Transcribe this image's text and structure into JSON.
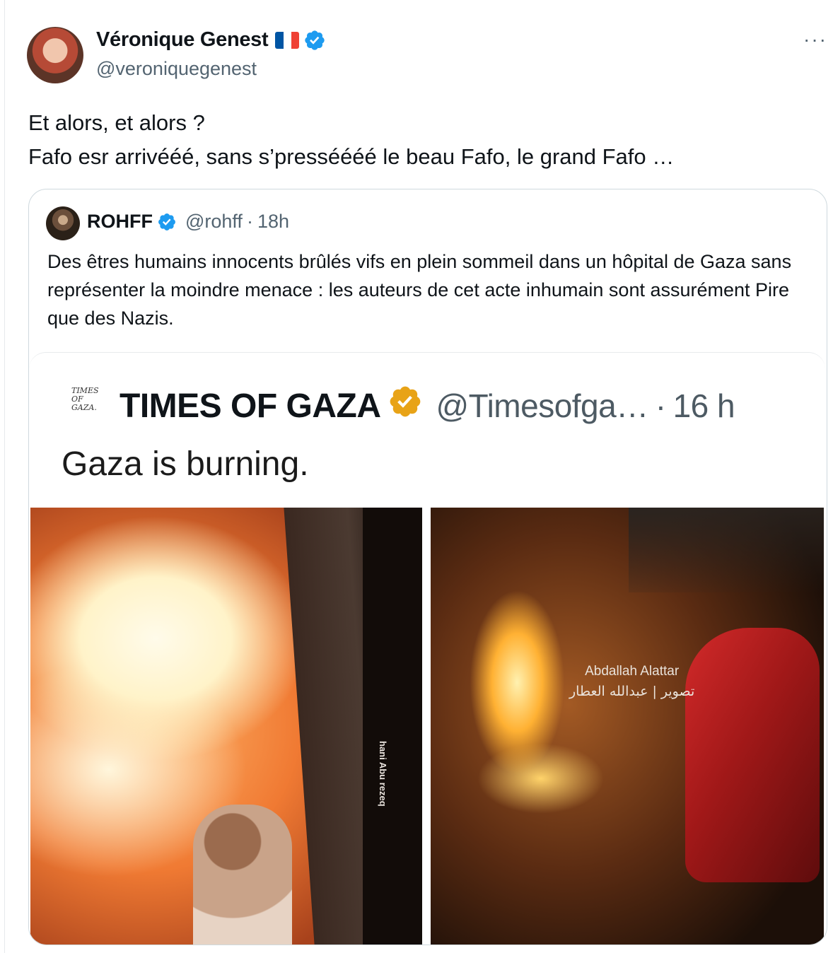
{
  "author": {
    "name": "Véronique Genest",
    "handle": "@veroniquegenest",
    "flag_colors": [
      "#0055a4",
      "#ffffff",
      "#ef4135"
    ],
    "verified_color": "#1d9bf0"
  },
  "menu": {
    "more_label": "···"
  },
  "tweet": {
    "lines": [
      "Et alors, et alors  ?",
      "Fafo esr arrivééé, sans s’presséééé le beau Fafo, le grand Fafo …"
    ]
  },
  "quote": {
    "name": "ROHFF",
    "handle": "@rohff",
    "time": "18h",
    "text": "Des êtres humains innocents brûlés vifs en plein sommeil dans un hôpital de Gaza sans représenter la moindre menace : les auteurs de cet acte inhumain sont assurément Pire que des Nazis."
  },
  "embedded": {
    "logo_text": [
      "TIMES",
      "OF",
      "GAZA."
    ],
    "name": "TIMES OF GAZA",
    "handle": "@Timesofga…",
    "time": "16 h",
    "badge_color": "#e8a317",
    "text": "Gaza is burning.",
    "photo_left_credit": "hani Abu rezeq",
    "photo_right_credit": "Abdallah Alattar",
    "photo_right_credit_ar": "تصوير | عبدالله العطار"
  }
}
